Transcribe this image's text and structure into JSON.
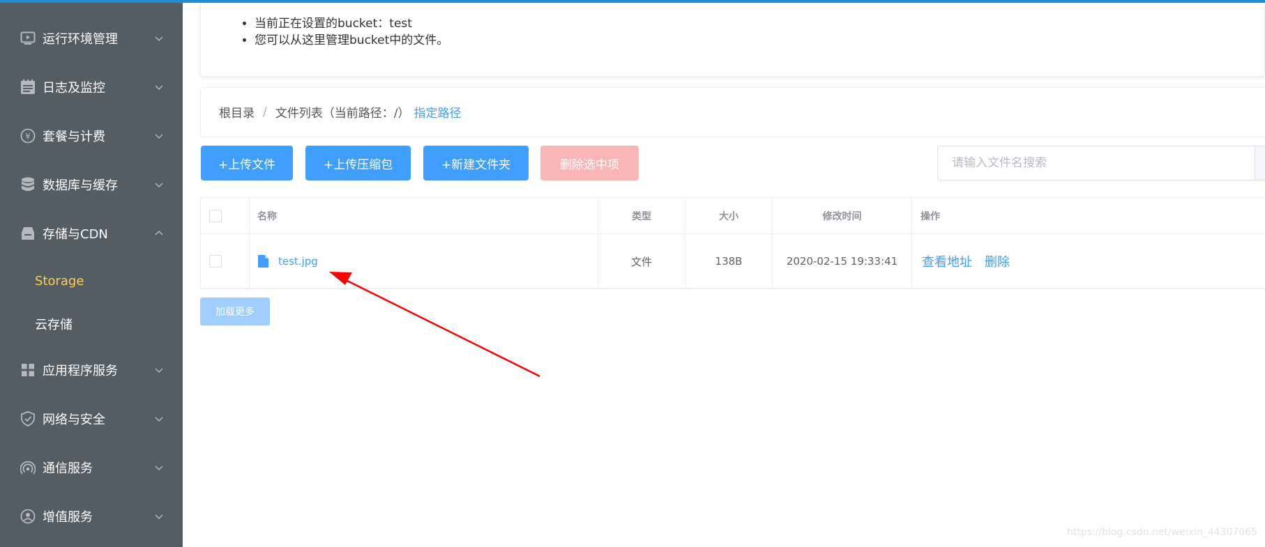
{
  "sidebar": {
    "items": [
      {
        "label": "运行环境管理",
        "icon": "monitor-icon"
      },
      {
        "label": "日志及监控",
        "icon": "log-icon"
      },
      {
        "label": "套餐与计费",
        "icon": "yen-icon"
      },
      {
        "label": "数据库与缓存",
        "icon": "database-icon"
      },
      {
        "label": "存储与CDN",
        "icon": "storage-icon"
      },
      {
        "label": "应用程序服务",
        "icon": "apps-grid-icon"
      },
      {
        "label": "网络与安全",
        "icon": "shield-icon"
      },
      {
        "label": "通信服务",
        "icon": "signal-icon"
      },
      {
        "label": "增值服务",
        "icon": "user-service-icon"
      }
    ],
    "sub_items": [
      {
        "label": "Storage",
        "active": true
      },
      {
        "label": "云存储",
        "active": false
      }
    ],
    "active_color": "#ffd04b",
    "bg_color": "#545c64"
  },
  "tips": [
    "当前正在设置的bucket：test",
    "您可以从这里管理bucket中的文件。"
  ],
  "breadcrumb": {
    "root": "根目录",
    "separator": "/",
    "current": "文件列表（当前路径：/）",
    "link": "指定路径"
  },
  "toolbar": {
    "upload_file": "+上传文件",
    "upload_zip": "+上传压缩包",
    "new_folder": "+新建文件夹",
    "delete_selected": "删除选中项"
  },
  "search": {
    "placeholder": "请输入文件名搜索"
  },
  "table": {
    "headers": {
      "name": "名称",
      "type": "类型",
      "size": "大小",
      "modified": "修改时间",
      "actions": "操作"
    },
    "rows": [
      {
        "name": "test.jpg",
        "type": "文件",
        "size": "138B",
        "modified": "2020-02-15 19:33:41",
        "action_view": "查看地址",
        "action_delete": "删除"
      }
    ]
  },
  "load_more": "加载更多",
  "watermark": "https://blog.csdn.net/weixin_44307065",
  "colors": {
    "primary": "#409eff",
    "danger_disabled": "#fab6b6",
    "annotation_arrow": "#ff0000"
  }
}
